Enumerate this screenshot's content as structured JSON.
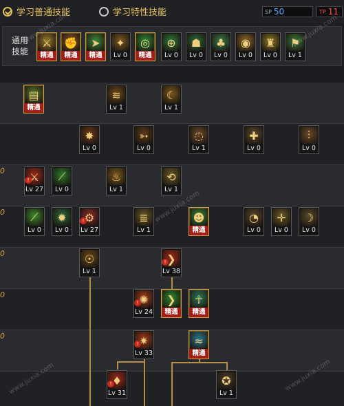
{
  "top": {
    "tab_normal": "学习普通技能",
    "tab_special": "学习特性技能",
    "sp_label": "SP",
    "sp_value": "50",
    "tp_label": "TP",
    "tp_value": "11"
  },
  "general": {
    "label": "通用技能",
    "skills": [
      {
        "icon": "rush-icon",
        "glyph": "⚔",
        "bg": "#9a7a2a",
        "lv": "精通",
        "maxed": true,
        "gold": true
      },
      {
        "icon": "fire-fist-icon",
        "glyph": "✊",
        "bg": "#8a5a22",
        "lv": "精通",
        "maxed": true,
        "gold": true
      },
      {
        "icon": "dash-icon",
        "glyph": "➤",
        "bg": "#3c8a3a",
        "lv": "精通",
        "maxed": true,
        "gold": true
      },
      {
        "icon": "wings-icon",
        "glyph": "✦",
        "bg": "#7a5a22",
        "lv": "Lv 0",
        "maxed": false,
        "gold": false
      },
      {
        "icon": "target-icon",
        "glyph": "◎",
        "bg": "#2e8a3a",
        "lv": "精通",
        "maxed": true,
        "gold": true
      },
      {
        "icon": "crosshair-icon",
        "glyph": "⊕",
        "bg": "#2e7a3a",
        "lv": "Lv 0",
        "maxed": false,
        "gold": false
      },
      {
        "icon": "flex-icon",
        "glyph": "☗",
        "bg": "#2e6a3a",
        "lv": "Lv 0",
        "maxed": false,
        "gold": false
      },
      {
        "icon": "mushroom-icon",
        "glyph": "♣",
        "bg": "#3a7a4a",
        "lv": "Lv 0",
        "maxed": false,
        "gold": false
      },
      {
        "icon": "vortex-icon",
        "glyph": "◉",
        "bg": "#8a6a2a",
        "lv": "Lv 0",
        "maxed": false,
        "gold": false
      },
      {
        "icon": "guard-icon",
        "glyph": "♜",
        "bg": "#8a7a2a",
        "lv": "Lv 0",
        "maxed": false,
        "gold": false
      },
      {
        "icon": "kick-icon",
        "glyph": "⚑",
        "bg": "#3a7a3a",
        "lv": "Lv 1",
        "maxed": false,
        "gold": false
      }
    ]
  },
  "row_marks": [
    "0",
    "0",
    "0",
    "0",
    "0"
  ],
  "tree": [
    {
      "name": "skill-book",
      "glyph": "▤",
      "bg": "#5a7a2a",
      "lv": "精通",
      "maxed": true,
      "gold": true,
      "lock": false
    },
    {
      "name": "skill-claw",
      "glyph": "≋",
      "bg": "#6a4a1a",
      "lv": "Lv 1",
      "maxed": false,
      "gold": false,
      "lock": false
    },
    {
      "name": "skill-slash",
      "glyph": "☾",
      "bg": "#7a5a1a",
      "lv": "Lv 1",
      "maxed": false,
      "gold": false,
      "lock": false
    },
    {
      "name": "skill-burst",
      "glyph": "✸",
      "bg": "#6a3a1a",
      "lv": "Lv 0",
      "maxed": false,
      "gold": false,
      "lock": false
    },
    {
      "name": "skill-arrow",
      "glyph": "➳",
      "bg": "#5a3a1a",
      "lv": "Lv 0",
      "maxed": false,
      "gold": false,
      "lock": false
    },
    {
      "name": "skill-wave",
      "glyph": "◌",
      "bg": "#6a4a2a",
      "lv": "Lv 1",
      "maxed": false,
      "gold": false,
      "lock": false
    },
    {
      "name": "skill-shield",
      "glyph": "✚",
      "bg": "#5a4a2a",
      "lv": "Lv 0",
      "maxed": false,
      "gold": false,
      "lock": false
    },
    {
      "name": "skill-triblade",
      "glyph": "⫶",
      "bg": "#6a4a2a",
      "lv": "Lv 0",
      "maxed": false,
      "gold": false,
      "lock": false
    },
    {
      "name": "skill-red-blade",
      "glyph": "⚔",
      "bg": "#a02a1a",
      "lv": "Lv 27",
      "maxed": false,
      "gold": false,
      "lock": true
    },
    {
      "name": "skill-green-sword",
      "glyph": "⟋",
      "bg": "#2a7a2a",
      "lv": "Lv 0",
      "maxed": false,
      "gold": false,
      "lock": false
    },
    {
      "name": "skill-flame-fall",
      "glyph": "♨",
      "bg": "#7a5a1a",
      "lv": "Lv 1",
      "maxed": false,
      "gold": false,
      "lock": false
    },
    {
      "name": "skill-cyclone",
      "glyph": "⟲",
      "bg": "#6a5a2a",
      "lv": "Lv 1",
      "maxed": false,
      "gold": false,
      "lock": false
    },
    {
      "name": "skill-green-blade",
      "glyph": "⟋",
      "bg": "#3a8a2a",
      "lv": "Lv 0",
      "maxed": false,
      "gold": false,
      "lock": false
    },
    {
      "name": "skill-green-star",
      "glyph": "✹",
      "bg": "#2a6a3a",
      "lv": "Lv 0",
      "maxed": false,
      "gold": false,
      "lock": false
    },
    {
      "name": "skill-gear",
      "glyph": "⚙",
      "bg": "#8a2a2a",
      "lv": "Lv 27",
      "maxed": false,
      "gold": false,
      "lock": true
    },
    {
      "name": "skill-tornado",
      "glyph": "≣",
      "bg": "#6a5a2a",
      "lv": "Lv 1",
      "maxed": false,
      "gold": false,
      "lock": false
    },
    {
      "name": "skill-aura",
      "glyph": "☻",
      "bg": "#3a8a3a",
      "lv": "精通",
      "maxed": true,
      "gold": true,
      "lock": false
    },
    {
      "name": "skill-spin",
      "glyph": "◔",
      "bg": "#5a4a2a",
      "lv": "Lv 0",
      "maxed": false,
      "gold": false,
      "lock": false
    },
    {
      "name": "skill-cross",
      "glyph": "✛",
      "bg": "#6a5a2a",
      "lv": "Lv 0",
      "maxed": false,
      "gold": false,
      "lock": false
    },
    {
      "name": "skill-moon",
      "glyph": "☽",
      "bg": "#5a4a2a",
      "lv": "Lv 0",
      "maxed": false,
      "gold": false,
      "lock": false
    },
    {
      "name": "skill-rage",
      "glyph": "☉",
      "bg": "#6a4a1a",
      "lv": "Lv 1",
      "maxed": false,
      "gold": false,
      "lock": false
    },
    {
      "name": "skill-red-arc",
      "glyph": "❯",
      "bg": "#a02a1a",
      "lv": "Lv 38",
      "maxed": false,
      "gold": false,
      "lock": true
    },
    {
      "name": "skill-sun",
      "glyph": "✺",
      "bg": "#a03a1a",
      "lv": "Lv 24",
      "maxed": false,
      "gold": false,
      "lock": true
    },
    {
      "name": "skill-green-arrow",
      "glyph": "❯",
      "bg": "#2a8a2a",
      "lv": "精通",
      "maxed": true,
      "gold": true,
      "lock": false
    },
    {
      "name": "skill-fighter",
      "glyph": "☥",
      "bg": "#2a7a5a",
      "lv": "精通",
      "maxed": true,
      "gold": true,
      "lock": false
    },
    {
      "name": "skill-eruption",
      "glyph": "✷",
      "bg": "#a03a1a",
      "lv": "Lv 33",
      "maxed": false,
      "gold": false,
      "lock": true
    },
    {
      "name": "skill-tide",
      "glyph": "≈",
      "bg": "#2a7a8a",
      "lv": "精通",
      "maxed": true,
      "gold": true,
      "lock": false
    },
    {
      "name": "skill-flame-pillar",
      "glyph": "♦",
      "bg": "#a02a1a",
      "lv": "Lv 31",
      "maxed": false,
      "gold": false,
      "lock": true
    },
    {
      "name": "skill-dark-vortex",
      "glyph": "✪",
      "bg": "#4a3a2a",
      "lv": "Lv 1",
      "maxed": false,
      "gold": false,
      "lock": false
    }
  ],
  "watermark": "www.juxia.com"
}
